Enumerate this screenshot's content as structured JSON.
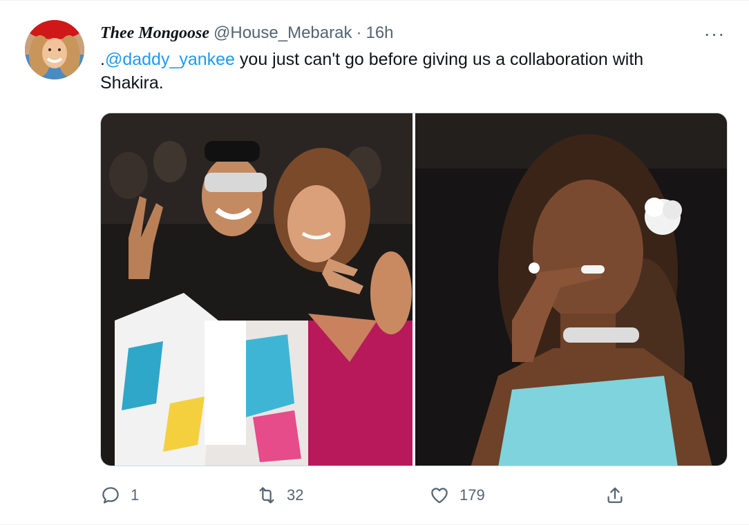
{
  "tweet": {
    "display_name": "Thee Mongoose",
    "handle": "@House_Mebarak",
    "separator": "·",
    "time": "16h",
    "text_prefix": ".",
    "mention": "@daddy_yankee",
    "text_rest": " you just can't go before giving us a collaboration with Shakira.",
    "more_label": "···"
  },
  "media": {
    "photos": [
      {
        "icon": "photo-couple-icon"
      },
      {
        "icon": "photo-crying-icon"
      }
    ]
  },
  "actions": {
    "reply_count": "1",
    "retweet_count": "32",
    "like_count": "179"
  },
  "colors": {
    "accent": "#1d9bf0",
    "secondary_text": "#536471",
    "border": "#cfd9de"
  }
}
